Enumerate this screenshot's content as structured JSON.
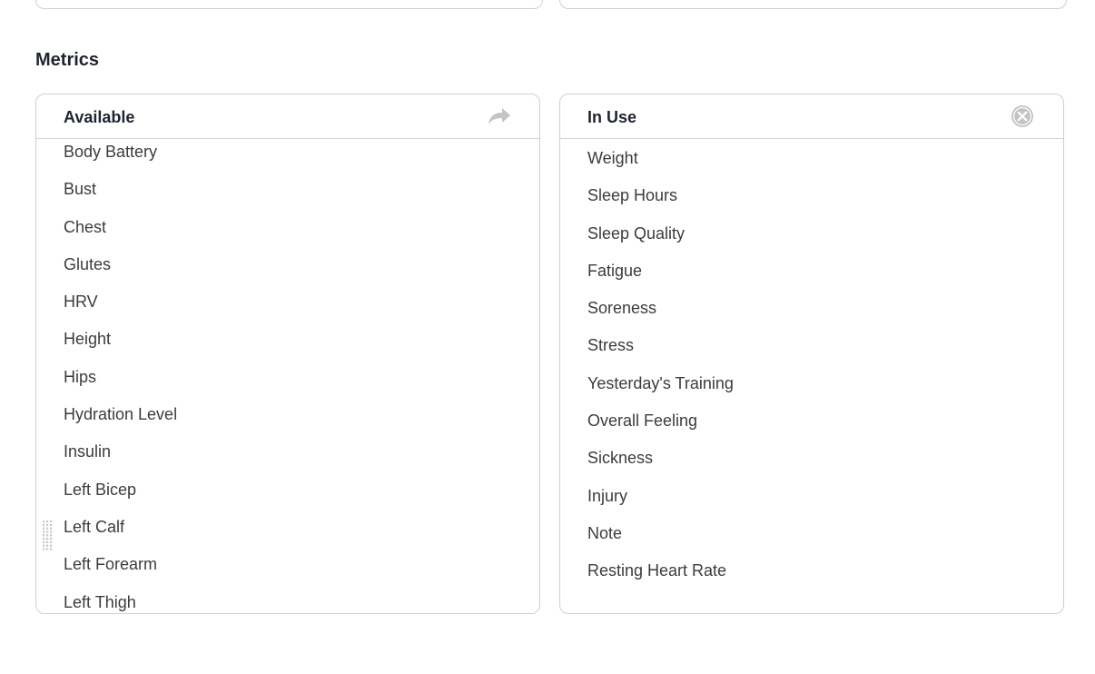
{
  "metrics": {
    "section_title": "Metrics",
    "available": {
      "title": "Available",
      "action_icon": "share-arrow-icon",
      "items": [
        "Body Battery",
        "Bust",
        "Chest",
        "Glutes",
        "HRV",
        "Height",
        "Hips",
        "Hydration Level",
        "Insulin",
        "Left Bicep",
        "Left Calf",
        "Left Forearm",
        "Left Thigh"
      ]
    },
    "in_use": {
      "title": "In Use",
      "action_icon": "clear-circle-icon",
      "items": [
        "Weight",
        "Sleep Hours",
        "Sleep Quality",
        "Fatigue",
        "Soreness",
        "Stress",
        "Yesterday's Training",
        "Overall Feeling",
        "Sickness",
        "Injury",
        "Note",
        "Resting Heart Rate"
      ]
    }
  },
  "colors": {
    "border": "#cfcfcf",
    "title": "#1f2430",
    "item_text": "#3c3c3c",
    "icon_gray": "#c4c4c4"
  }
}
